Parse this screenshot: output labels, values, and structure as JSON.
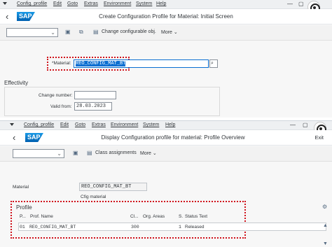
{
  "window1": {
    "menu": [
      "Config. profile",
      "Edit",
      "Goto",
      "Extras",
      "Environment",
      "System",
      "Help"
    ],
    "title": "Create Configuration Profile for Material: Initial Screen",
    "logo": "SAP",
    "toolbar": {
      "change_configurable": "Change configurable obj.",
      "more": "More"
    },
    "material_label": "*Material:",
    "material_value": "REO_CONFIG_MAT_BT",
    "effectivity_title": "Effectivity",
    "change_number_label": "Change number:",
    "change_number_value": "",
    "valid_from_label": "Valid from:",
    "valid_from_value": "28.03.2023"
  },
  "window2": {
    "menu": [
      "Config. profile",
      "Edit",
      "Goto",
      "Extras",
      "Environment",
      "System",
      "Help"
    ],
    "title": "Display Configuration profile for material: Profile Overview",
    "logo": "SAP",
    "exit": "Exit",
    "toolbar": {
      "class_assignments": "Class assignments",
      "more": "More"
    },
    "material_label": "Material",
    "material_value": "REO_CONFIG_MAT_BT",
    "material_desc": "Cfig material",
    "profile_title": "Profile",
    "columns": [
      "P...",
      "Prof. Name",
      "Cl...",
      "Org. Areas",
      "S.",
      "Status Text"
    ],
    "rows": [
      {
        "p": "01",
        "name": "REO_CONFIG_MAT_BT",
        "cl": "300",
        "org": "",
        "s": "1",
        "status": "Released"
      }
    ]
  },
  "colors": {
    "highlight": "#d0121b",
    "sap_blue": "#0a6ed1",
    "background": "#f7f7f7"
  }
}
